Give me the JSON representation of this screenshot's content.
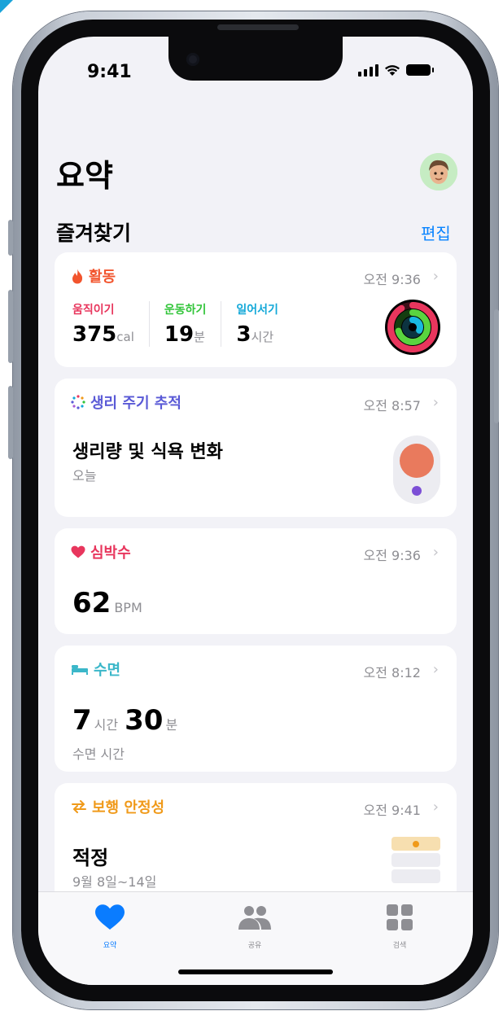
{
  "status": {
    "time": "9:41"
  },
  "header": {
    "title": "요약",
    "avatar_icon": "memoji-avatar"
  },
  "favorites": {
    "title": "즐겨찾기",
    "edit_label": "편집"
  },
  "cards": {
    "activity": {
      "title": "활동",
      "time": "오전 9:36",
      "color": "#f2542d",
      "move": {
        "label": "움직이기",
        "value": "375",
        "unit": "cal",
        "color": "#e8365d"
      },
      "exercise": {
        "label": "운동하기",
        "value": "19",
        "unit": "분",
        "color": "#32c53a"
      },
      "stand": {
        "label": "일어서기",
        "value": "3",
        "unit": "시간",
        "color": "#12a8d8"
      }
    },
    "cycle": {
      "title": "생리 주기 추적",
      "time": "오전 8:57",
      "headline": "생리량 및 식욕 변화",
      "subtitle": "오늘",
      "color": "#5a5ad6"
    },
    "heart": {
      "title": "심박수",
      "time": "오전 9:36",
      "value": "62",
      "unit": "BPM",
      "color": "#e8365d"
    },
    "sleep": {
      "title": "수면",
      "time": "오전 8:12",
      "hours": "7",
      "hours_unit": "시간",
      "minutes": "30",
      "minutes_unit": "분",
      "subtitle": "수면 시간",
      "color": "#3bb7c9"
    },
    "walking": {
      "title": "보행 안정성",
      "time": "오전 9:41",
      "headline": "적정",
      "subtitle": "9월 8일~14일",
      "color": "#f09a1a"
    }
  },
  "tabbar": {
    "summary": {
      "label": "요약",
      "icon": "heart-icon"
    },
    "sharing": {
      "label": "공유",
      "icon": "people-icon"
    },
    "browse": {
      "label": "검색",
      "icon": "grid-icon"
    },
    "active_color": "#0a7cff"
  }
}
